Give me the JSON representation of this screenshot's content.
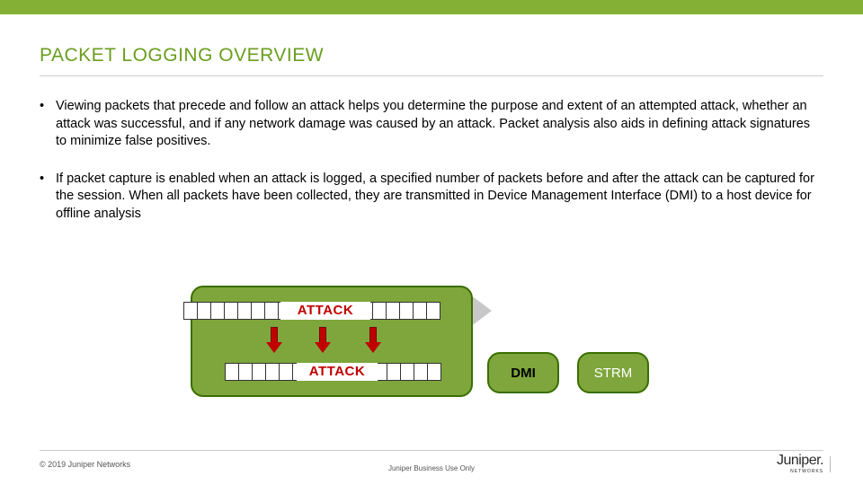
{
  "title": "PACKET LOGGING OVERVIEW",
  "bullets": [
    "Viewing packets that precede and follow an attack helps you determine the purpose and extent of an attempted attack, whether an attack was successful, and if any network damage was caused by an attack. Packet analysis also aids in defining attack signatures to minimize false positives.",
    "If packet capture is enabled when an attack is logged, a specified number of packets before and after the attack can be captured for the session. When all packets have been collected, they are transmitted in Device Management Interface (DMI) to a host device for offline analysis"
  ],
  "diagram": {
    "attack_label": "ATTACK",
    "dmi_label": "DMI",
    "strm_label": "STRM"
  },
  "footer": {
    "copyright": "© 2019 Juniper Networks",
    "biz_only": "Juniper Business Use Only",
    "logo_text": "Juniper",
    "logo_sub": "NETWORKS"
  }
}
